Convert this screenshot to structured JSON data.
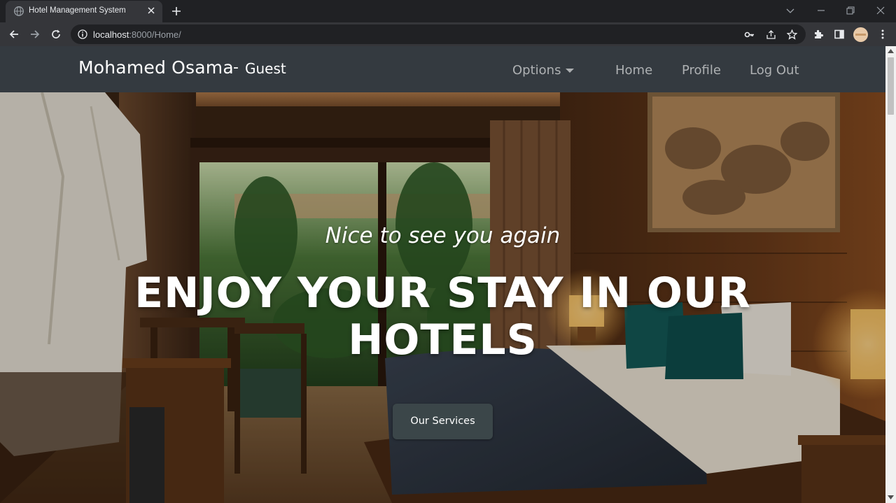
{
  "browser": {
    "tab_title": "Hotel Management System",
    "url_host": "localhost",
    "url_rest": ":8000/Home/"
  },
  "navbar": {
    "brand_name": "Mohamed Osama",
    "brand_separator": "-",
    "brand_role": "Guest",
    "links": {
      "options": "Options",
      "home": "Home",
      "profile": "Profile",
      "logout": "Log Out"
    }
  },
  "hero": {
    "subheading": "Nice to see you again",
    "heading": "ENJOY YOUR STAY IN OUR HOTELS",
    "cta_label": "Our Services"
  },
  "colors": {
    "navbar_bg": "#343a40",
    "cta_bg": "#3b4649",
    "browser_tab_bg": "#35363a",
    "browser_frame_bg": "#202124"
  },
  "icons": [
    "globe-icon",
    "close-icon",
    "plus-icon",
    "chevron-down-icon",
    "minimize-icon",
    "restore-icon",
    "back-icon",
    "forward-icon",
    "reload-icon",
    "info-icon",
    "key-icon",
    "share-icon",
    "star-icon",
    "puzzle-icon",
    "sidebar-icon",
    "avatar",
    "more-icon",
    "caret-down-icon"
  ]
}
